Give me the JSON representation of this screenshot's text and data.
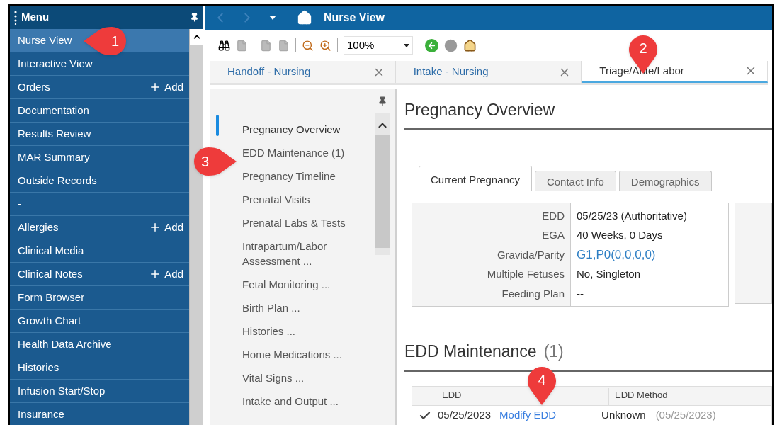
{
  "menu": {
    "title": "Menu",
    "items": [
      {
        "label": "Nurse View",
        "selected": true
      },
      {
        "label": "Interactive View",
        "selected": false
      },
      {
        "label": "Orders",
        "selected": false,
        "action": "Add"
      },
      {
        "label": "Documentation",
        "selected": false
      },
      {
        "label": "Results Review",
        "selected": false
      },
      {
        "label": "MAR Summary",
        "selected": false
      },
      {
        "label": "Outside Records",
        "selected": false
      },
      {
        "label": "-",
        "selected": false
      },
      {
        "label": "Allergies",
        "selected": false,
        "action": "Add"
      },
      {
        "label": "Clinical Media",
        "selected": false
      },
      {
        "label": "Clinical Notes",
        "selected": false,
        "action": "Add"
      },
      {
        "label": "Form Browser",
        "selected": false
      },
      {
        "label": "Growth Chart",
        "selected": false
      },
      {
        "label": "Health Data Archive",
        "selected": false
      },
      {
        "label": "Histories",
        "selected": false
      },
      {
        "label": "Infusion Start/Stop",
        "selected": false
      },
      {
        "label": "Insurance",
        "selected": false
      }
    ]
  },
  "header": {
    "title": "Nurse View"
  },
  "toolbar": {
    "zoom": "100%"
  },
  "tabs": [
    {
      "label": "Handoff - Nursing",
      "selected": false
    },
    {
      "label": "Intake - Nursing",
      "selected": false
    },
    {
      "label": "Triage/Ante/Labor",
      "selected": true
    }
  ],
  "section_nav": [
    {
      "label": "Pregnancy Overview",
      "selected": true
    },
    {
      "label": "EDD Maintenance (1)",
      "selected": false
    },
    {
      "label": "Pregnancy Timeline",
      "selected": false
    },
    {
      "label": "Prenatal Visits",
      "selected": false
    },
    {
      "label": "Prenatal Labs & Tests",
      "selected": false
    },
    {
      "label": "Intrapartum/Labor Assessment ...",
      "selected": false
    },
    {
      "label": "Fetal Monitoring ...",
      "selected": false
    },
    {
      "label": "Birth Plan ...",
      "selected": false
    },
    {
      "label": "Histories ...",
      "selected": false
    },
    {
      "label": "Home Medications ...",
      "selected": false
    },
    {
      "label": "Vital Signs ...",
      "selected": false
    },
    {
      "label": "Intake and Output ...",
      "selected": false
    }
  ],
  "overview": {
    "title": "Pregnancy Overview",
    "subtabs": [
      {
        "label": "Current Pregnancy",
        "selected": true
      },
      {
        "label": "Contact Info",
        "selected": false
      },
      {
        "label": "Demographics",
        "selected": false
      }
    ],
    "fields": [
      {
        "label": "EDD",
        "value": "05/25/23 (Authoritative)",
        "kind": "text"
      },
      {
        "label": "EGA",
        "value": "40 Weeks, 0 Days",
        "kind": "text"
      },
      {
        "label": "Gravida/Parity",
        "value": "G1,P0(0,0,0,0)",
        "kind": "link"
      },
      {
        "label": "Multiple Fetuses",
        "value": "No, Singleton",
        "kind": "text"
      },
      {
        "label": "Feeding Plan",
        "value": "--",
        "kind": "text"
      }
    ]
  },
  "edd": {
    "title": "EDD Maintenance",
    "count": "(1)",
    "columns": [
      "EDD",
      "EDD Method"
    ],
    "rows": [
      {
        "checked": true,
        "date": "05/25/2023",
        "action": "Modify EDD",
        "method": "Unknown",
        "method_date": "(05/25/2023)"
      }
    ]
  },
  "callouts": [
    {
      "label": "1",
      "kind": "left"
    },
    {
      "label": "2",
      "kind": "pin"
    },
    {
      "label": "3",
      "kind": "right"
    },
    {
      "label": "4",
      "kind": "pin"
    }
  ]
}
